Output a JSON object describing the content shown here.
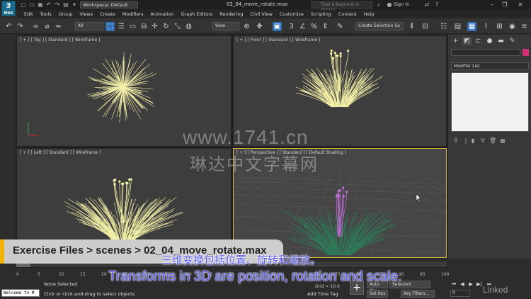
{
  "app": {
    "logo_text": "3",
    "logo_sub": "MAX",
    "workspace": "Workspace: Default",
    "document_title": "02_04_move_rotate.max",
    "search_placeholder": "Type a keyword or phrase",
    "sign_in": "Sign In"
  },
  "menu": [
    "Edit",
    "Tools",
    "Group",
    "Views",
    "Create",
    "Modifiers",
    "Animation",
    "Graph Editors",
    "Rendering",
    "Civil View",
    "Customize",
    "Scripting",
    "Content",
    "Help"
  ],
  "toolbar": {
    "filter_dropdown": "All",
    "ref_coord_dropdown": "View",
    "selection_set_dropdown": "Create Selection Se"
  },
  "viewports": {
    "top": "[ + ] [ Top ] [ Standard ] [ Wireframe ]",
    "front": "[ + ] [ Front ] [ Standard ] [ Wireframe ]",
    "left": "[ + ] [ Left ] [ Standard ] [ Wireframe ]",
    "perspective": "[ + ] [ Perspective ] [ Standard ] [ Default Shading ]"
  },
  "command_panel": {
    "modifier_list": "Modifier List"
  },
  "timeline": {
    "ticks": [
      "0",
      "5",
      "10",
      "15",
      "20",
      "25",
      "30",
      "35",
      "40",
      "45",
      "50",
      "55",
      "60",
      "65",
      "70",
      "75",
      "80",
      "85",
      "90",
      "95",
      "100"
    ]
  },
  "status": {
    "maxscript": "Welcome to M",
    "selection": "None Selected",
    "prompt": "Click or click-and-drag to select objects",
    "grid": "Grid = 10.0",
    "add_time_tag": "Add Time Tag",
    "auto_key": "Auto Key",
    "selected": "Selected",
    "set_key": "Set Key",
    "key_filters": "Key Filters...",
    "frame": "0"
  },
  "overlays": {
    "exercise_path": "Exercise Files > scenes > 02_04_move_rotate.max",
    "watermark_url": "www.1741.cn",
    "watermark_cn": "琳达中文字幕网",
    "subtitle_cn": "三维变换包括位置、旋转和缩放。",
    "subtitle_en": "Transforms in 3D are position, rotation and scale.",
    "brand": "Linked"
  },
  "colors": {
    "plant_wire": "#f3f0a8",
    "active_viewport": "#d8b23b",
    "selection_blue": "#2d6fb5",
    "grass_green": "#2e7a58",
    "flower_pink": "#c070d8"
  }
}
